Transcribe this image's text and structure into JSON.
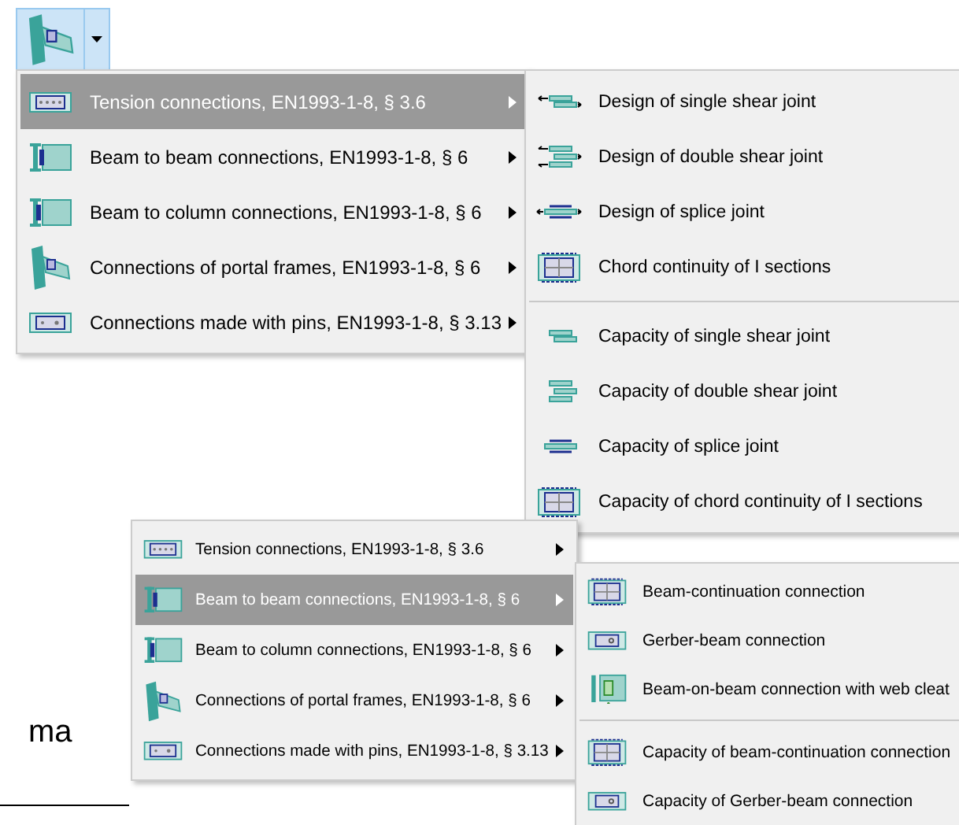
{
  "toolbar": {
    "button": {
      "kind": "frame",
      "pressed": true
    }
  },
  "menus": [
    {
      "items": [
        {
          "label": "Tension connections,  EN1993-1-8, § 3.6",
          "kind": "plate",
          "selected": true
        },
        {
          "label": "Beam to beam connections,  EN1993-1-8, § 6",
          "kind": "beam",
          "selected": false
        },
        {
          "label": "Beam to column connections,  EN1993-1-8, § 6",
          "kind": "column",
          "selected": false
        },
        {
          "label": "Connections of portal frames,  EN1993-1-8, § 6",
          "kind": "frame",
          "selected": false
        },
        {
          "label": "Connections made with pins,  EN1993-1-8, § 3.13",
          "kind": "pins",
          "selected": false
        }
      ],
      "submenu": {
        "groups": [
          [
            {
              "label": "Design of single shear joint",
              "kind": "single-arrows"
            },
            {
              "label": "Design of double shear joint",
              "kind": "double-arrows"
            },
            {
              "label": "Design of splice joint",
              "kind": "splice-arrows"
            },
            {
              "label": "Chord continuity of I sections",
              "kind": "chord"
            }
          ],
          [
            {
              "label": "Capacity of single shear joint",
              "kind": "single"
            },
            {
              "label": "Capacity of double shear joint",
              "kind": "double"
            },
            {
              "label": "Capacity of splice joint",
              "kind": "splice"
            },
            {
              "label": "Capacity of chord continuity of I sections",
              "kind": "chord"
            }
          ]
        ]
      }
    },
    {
      "items": [
        {
          "label": "Tension connections,  EN1993-1-8, § 3.6",
          "kind": "plate",
          "selected": false
        },
        {
          "label": "Beam to beam connections,  EN1993-1-8, § 6",
          "kind": "beam",
          "selected": true
        },
        {
          "label": "Beam to column connections,  EN1993-1-8, § 6",
          "kind": "column",
          "selected": false
        },
        {
          "label": "Connections of portal frames,  EN1993-1-8, § 6",
          "kind": "frame",
          "selected": false
        },
        {
          "label": "Connections made with pins,  EN1993-1-8, § 3.13",
          "kind": "pins",
          "selected": false
        }
      ],
      "submenu": {
        "groups": [
          [
            {
              "label": "Beam-continuation connection",
              "kind": "chord"
            },
            {
              "label": "Gerber-beam connection",
              "kind": "gerber"
            },
            {
              "label": "Beam-on-beam connection with web cleat",
              "kind": "cleat"
            }
          ],
          [
            {
              "label": "Capacity of beam-continuation connection",
              "kind": "chord"
            },
            {
              "label": "Capacity of Gerber-beam connection",
              "kind": "gerber"
            }
          ]
        ]
      }
    }
  ],
  "background_text": "ma"
}
